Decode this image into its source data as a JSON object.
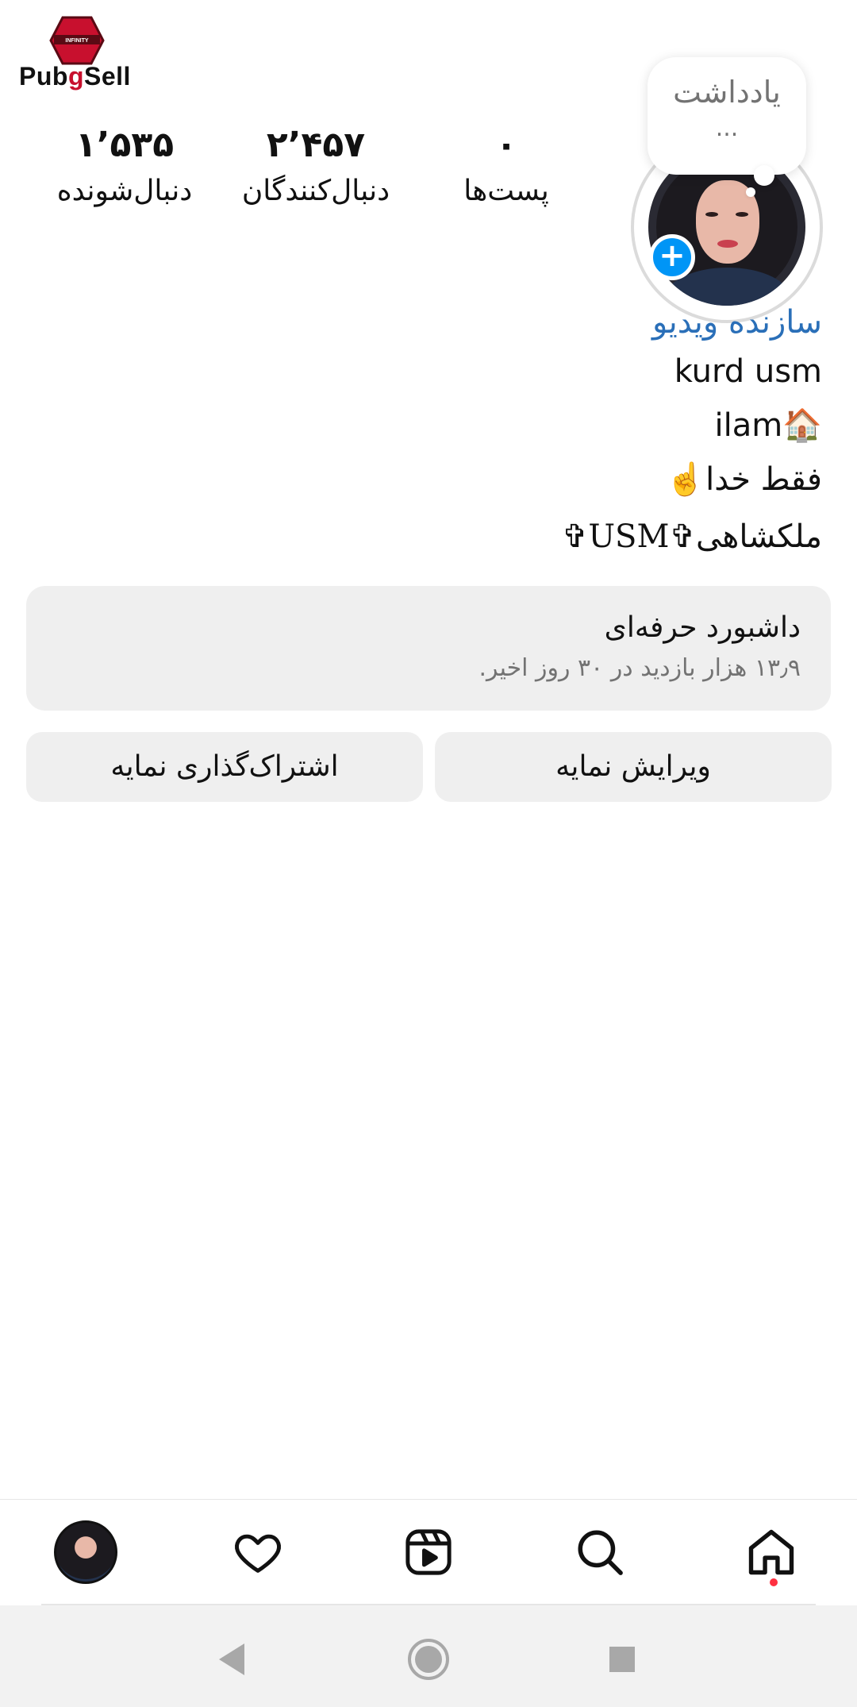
{
  "watermark": {
    "band_text": "INFINITY",
    "word_left": "Pub",
    "word_g": "g",
    "word_right": "Sell"
  },
  "note": {
    "title": "یادداشت",
    "dots": "..."
  },
  "stats": {
    "posts": {
      "value": "۰",
      "label": "پست‌ها"
    },
    "followers": {
      "value": "۲٬۴۵۷",
      "label": "دنبال‌کنندگان"
    },
    "following": {
      "value": "۱٬۵۳۵",
      "label": "دنبال‌شونده"
    }
  },
  "bio": {
    "category": "سازنده ویدیو",
    "lines": [
      "kurd usm",
      "ilam🏠",
      "فقط خدا☝️",
      "ملکشاهی✞USM✞"
    ]
  },
  "dashboard": {
    "title": "داشبورد حرفه‌ای",
    "subtitle": "۱۳٫۹ هزار بازدید در ۳۰ روز اخیر."
  },
  "buttons": {
    "edit": "ویرایش نمایه",
    "share": "اشتراک‌گذاری نمایه"
  },
  "nav": {
    "items": [
      "home-icon",
      "search-icon",
      "reels-icon",
      "heart-icon",
      "profile-avatar"
    ],
    "notification_color": "#ff3040"
  },
  "colors": {
    "accent": "#0095f6",
    "category_text": "#2a6fb8",
    "button_bg": "#efefef"
  }
}
